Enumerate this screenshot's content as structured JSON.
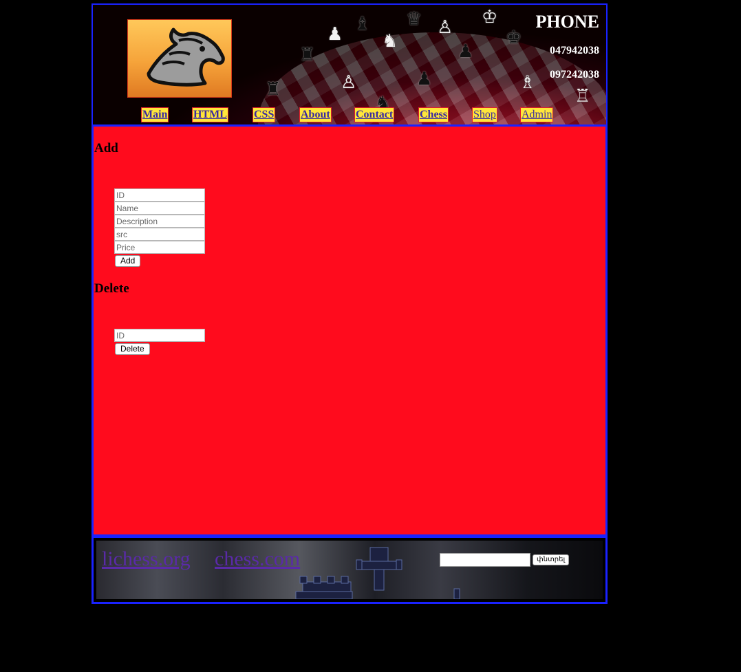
{
  "header": {
    "phone_title": "PHONE",
    "phones": [
      "047942038",
      "097242038"
    ],
    "logo_icon": "horse-head-icon"
  },
  "nav": {
    "items": [
      {
        "label": "Main",
        "bold": true
      },
      {
        "label": "HTML",
        "bold": true
      },
      {
        "label": "CSS",
        "bold": true
      },
      {
        "label": "About",
        "bold": true
      },
      {
        "label": "Contact",
        "bold": true
      },
      {
        "label": "Chess",
        "bold": true
      },
      {
        "label": "Shop",
        "bold": false
      },
      {
        "label": "Admin",
        "bold": false
      }
    ]
  },
  "add_form": {
    "title": "Add",
    "id_placeholder": "ID",
    "name_placeholder": "Name",
    "description_placeholder": "Description",
    "src_placeholder": "src",
    "price_placeholder": "Price",
    "button_label": "Add"
  },
  "delete_form": {
    "title": "Delete",
    "id_placeholder": "ID",
    "button_label": "Delete"
  },
  "footer": {
    "links": [
      "lichess.org",
      "chess.com"
    ],
    "search_value": "",
    "search_button": "փնտրել"
  },
  "colors": {
    "page_background": "#000000",
    "border": "#1a22ff",
    "main_background": "#ff0b1d",
    "nav_background": "#ffe63a",
    "link": "#5a2aa8"
  }
}
